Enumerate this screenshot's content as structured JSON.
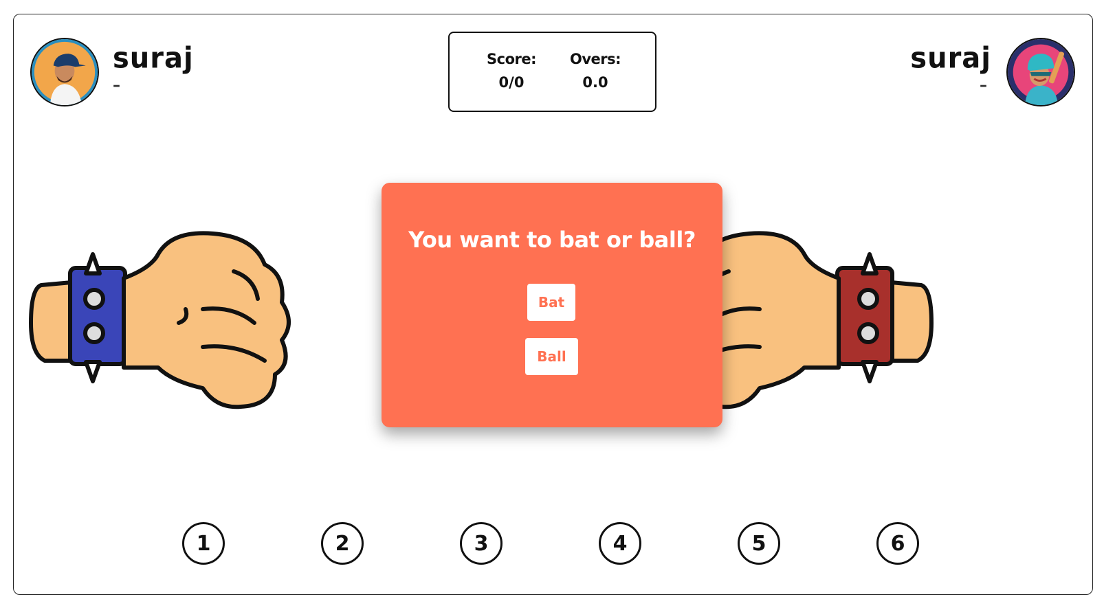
{
  "player_left": {
    "name": "suraj",
    "status": "–",
    "avatar_icon": "batsman-avatar-icon"
  },
  "player_right": {
    "name": "suraj",
    "status": "–",
    "avatar_icon": "helmet-batsman-avatar-icon"
  },
  "scoreboard": {
    "score_label": "Score:",
    "score_value": "0/0",
    "overs_label": "Overs:",
    "overs_value": "0.0"
  },
  "modal": {
    "question": "You want to bat or ball?",
    "bat_label": "Bat",
    "ball_label": "Ball"
  },
  "numbers": [
    "1",
    "2",
    "3",
    "4",
    "5",
    "6"
  ],
  "hands": {
    "left_band_color": "#3a45b8",
    "right_band_color": "#a8302c",
    "skin_color": "#f9c17f"
  },
  "colors": {
    "modal_bg": "#ff7152",
    "button_text": "#ff7152",
    "border": "#111111"
  }
}
